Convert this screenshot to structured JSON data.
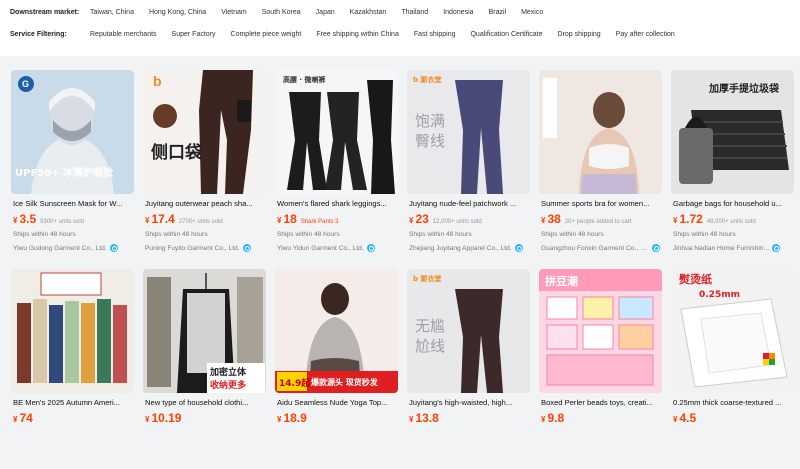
{
  "filters": {
    "market_label": "Downstream market:",
    "markets": [
      "Taiwan, China",
      "Hong Kong, China",
      "Vietnam",
      "South Korea",
      "Japan",
      "Kazakhstan",
      "Thailand",
      "Indonesia",
      "Brazil",
      "Mexico"
    ],
    "service_label": "Service Filtering:",
    "services": [
      "Reputable merchants",
      "Super Factory",
      "Complete piece weight",
      "Free shipping within China",
      "Fast shipping",
      "Qualification Certificate",
      "Drop shipping",
      "Pay after collection"
    ]
  },
  "products": [
    {
      "title": "Ice Silk Sunscreen Mask for W...",
      "currency": "¥",
      "price": "3.5",
      "sold": "9300+ units sold",
      "ship": "Ships within 48 hours",
      "supplier": "Yiwu Gudong Garment Co., Ltd.",
      "image_icon": "sunscreen-mask-photo-icon",
      "overlay": "UPF50+ 冰薄护眼脸",
      "overlay2": "",
      "logo": "G"
    },
    {
      "title": "Juyitang outerwear peach sha...",
      "currency": "¥",
      "price": "17.4",
      "sold": "2700+ units sold",
      "ship": "Ships within 48 hours",
      "supplier": "Puning Fuyito Garment Co., Ltd.",
      "image_icon": "leggings-pocket-photo-icon",
      "overlay": "侧口袋",
      "overlay2": "",
      "logo": "b"
    },
    {
      "title": "Women's flared shark leggings...",
      "currency": "¥",
      "price": "18",
      "sold": "Shark Pants 3",
      "ship": "Ships within 48 hours",
      "supplier": "Yiwu Yidun Garment Co., Ltd.",
      "image_icon": "flared-pants-photo-icon",
      "overlay": "高腰 · 微喇裤",
      "overlay2": "",
      "logo": ""
    },
    {
      "title": "Juyitang nude-feel patchwork ...",
      "currency": "¥",
      "price": "23",
      "sold": "12,000+ units sold",
      "ship": "Ships within 48 hours",
      "supplier": "Zhejiang Juyitang Apparel Co., Ltd.",
      "image_icon": "patchwork-leggings-photo-icon",
      "overlay": "饱满",
      "overlay2": "臀线",
      "logo": "b 聚衣堂"
    },
    {
      "title": "Summer sports bra for women...",
      "currency": "¥",
      "price": "38",
      "sold": "20+ people added to cart",
      "ship": "Ships within 48 hours",
      "supplier": "Guangzhou Fonxin Garment Co., Ltd.",
      "image_icon": "sports-bra-photo-icon",
      "overlay": "",
      "overlay2": "",
      "logo": ""
    },
    {
      "title": "Garbage bags for household u...",
      "currency": "¥",
      "price": "1.72",
      "sold": "48,000+ units sold",
      "ship": "Ships within 48 hours",
      "supplier": "Jinhua Nadian Home Furnishin...",
      "image_icon": "garbage-bags-photo-icon",
      "overlay": "加厚手提垃圾袋",
      "overlay2": "",
      "logo": ""
    },
    {
      "title": "BE Men's 2025 Autumn Ameri...",
      "currency": "¥",
      "price": "74",
      "sold": "",
      "ship": "",
      "supplier": "",
      "image_icon": "tracksuits-photo-icon",
      "overlay": "",
      "overlay2": "",
      "logo": ""
    },
    {
      "title": "New type of household clothi...",
      "currency": "¥",
      "price": "10.19",
      "sold": "",
      "ship": "",
      "supplier": "",
      "image_icon": "garment-bag-photo-icon",
      "overlay": "加密立体",
      "overlay2": "收纳更多",
      "logo": ""
    },
    {
      "title": "Aidu Seamless Nude Yoga Top...",
      "currency": "¥",
      "price": "18.9",
      "sold": "",
      "ship": "",
      "supplier": "",
      "image_icon": "yoga-top-photo-icon",
      "overlay": "14.9起",
      "overlay2": "爆款源头 现货秒发",
      "logo": ""
    },
    {
      "title": "Juyitang's high-waisted, high...",
      "currency": "¥",
      "price": "13.8",
      "sold": "",
      "ship": "",
      "supplier": "",
      "image_icon": "high-waist-leggings-photo-icon",
      "overlay": "无尴",
      "overlay2": "尬线",
      "logo": "b 聚衣堂"
    },
    {
      "title": "Boxed Perler beads toys, creati...",
      "currency": "¥",
      "price": "9.8",
      "sold": "",
      "ship": "",
      "supplier": "",
      "image_icon": "perler-beads-photo-icon",
      "overlay": "拼豆潮",
      "overlay2": "",
      "logo": ""
    },
    {
      "title": "0.25mm thick coarse-textured ...",
      "currency": "¥",
      "price": "4.5",
      "sold": "",
      "ship": "",
      "supplier": "",
      "image_icon": "bead-sheet-photo-icon",
      "overlay": "熨烫纸",
      "overlay2": "0.25mm",
      "logo": ""
    }
  ]
}
